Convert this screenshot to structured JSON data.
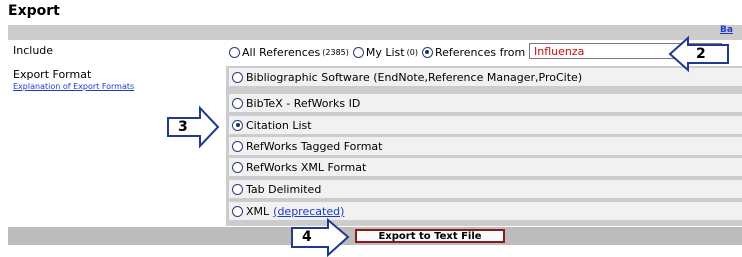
{
  "page": {
    "title": "Export",
    "back_link": "Ba"
  },
  "include": {
    "label": "Include",
    "options": [
      {
        "label": "All References",
        "count": "(2385)",
        "selected": false
      },
      {
        "label": "My List",
        "count": "(0)",
        "selected": false
      },
      {
        "label": "References from",
        "count": "",
        "selected": true
      }
    ],
    "select_value": "Influenza"
  },
  "export_format": {
    "label": "Export Format",
    "explanation_link": "Explanation of Export Formats",
    "options": [
      {
        "label": "Bibliographic Software (EndNote,Reference Manager,ProCite)",
        "selected": false
      },
      {
        "label": "BibTeX - RefWorks ID",
        "selected": false
      },
      {
        "label": "Citation List",
        "selected": true
      },
      {
        "label": "RefWorks Tagged Format",
        "selected": false
      },
      {
        "label": "RefWorks XML Format",
        "selected": false
      },
      {
        "label": "Tab Delimited",
        "selected": false
      },
      {
        "label": "XML",
        "link": "(deprecated)",
        "selected": false
      }
    ]
  },
  "actions": {
    "export_button": "Export to Text File"
  },
  "callouts": {
    "two": "2",
    "three": "3",
    "four": "4"
  }
}
